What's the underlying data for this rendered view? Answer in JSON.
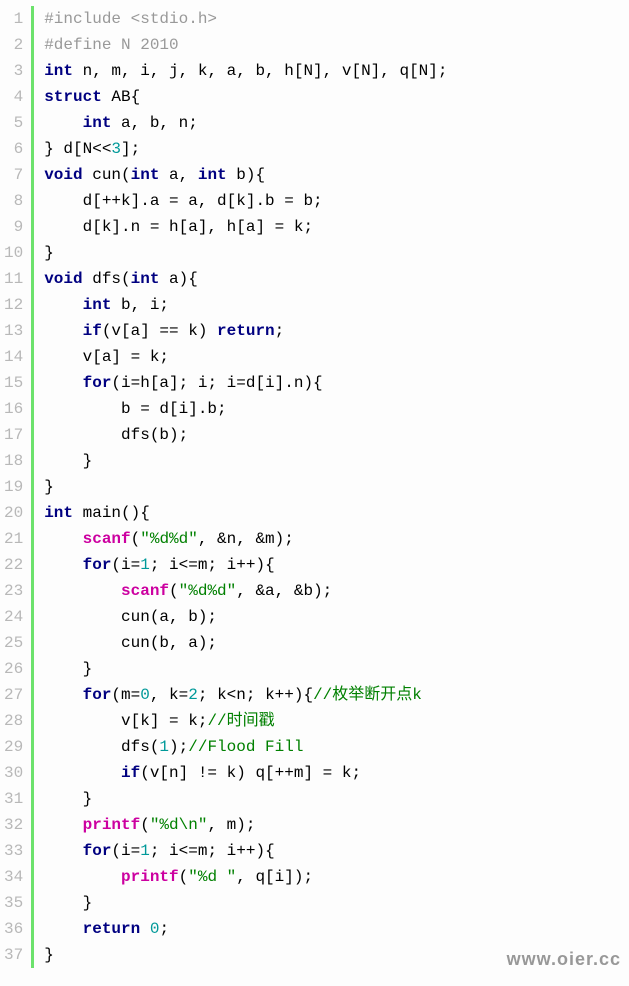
{
  "lineCount": 37,
  "lines": [
    [
      {
        "c": "kw-pp",
        "t": "#include <stdio.h>"
      }
    ],
    [
      {
        "c": "kw-pp",
        "t": "#define N 2010"
      }
    ],
    [
      {
        "c": "kw-type",
        "t": "int"
      },
      {
        "c": "id",
        "t": " n, m, i, j, k, a, b, h[N], v[N], q[N];"
      }
    ],
    [
      {
        "c": "kw-type",
        "t": "struct"
      },
      {
        "c": "id",
        "t": " AB{"
      }
    ],
    [
      {
        "c": "id",
        "t": "    "
      },
      {
        "c": "kw-type",
        "t": "int"
      },
      {
        "c": "id",
        "t": " a, b, n;"
      }
    ],
    [
      {
        "c": "id",
        "t": "} d[N<<"
      },
      {
        "c": "num",
        "t": "3"
      },
      {
        "c": "id",
        "t": "];"
      }
    ],
    [
      {
        "c": "kw-type",
        "t": "void"
      },
      {
        "c": "id",
        "t": " cun("
      },
      {
        "c": "kw-type",
        "t": "int"
      },
      {
        "c": "id",
        "t": " a, "
      },
      {
        "c": "kw-type",
        "t": "int"
      },
      {
        "c": "id",
        "t": " b){"
      }
    ],
    [
      {
        "c": "id",
        "t": "    d[++k].a = a, d[k].b = b;"
      }
    ],
    [
      {
        "c": "id",
        "t": "    d[k].n = h[a], h[a] = k;"
      }
    ],
    [
      {
        "c": "id",
        "t": "}"
      }
    ],
    [
      {
        "c": "kw-type",
        "t": "void"
      },
      {
        "c": "id",
        "t": " dfs("
      },
      {
        "c": "kw-type",
        "t": "int"
      },
      {
        "c": "id",
        "t": " a){"
      }
    ],
    [
      {
        "c": "id",
        "t": "    "
      },
      {
        "c": "kw-type",
        "t": "int"
      },
      {
        "c": "id",
        "t": " b, i;"
      }
    ],
    [
      {
        "c": "id",
        "t": "    "
      },
      {
        "c": "kw-ctrl",
        "t": "if"
      },
      {
        "c": "id",
        "t": "(v[a] == k) "
      },
      {
        "c": "kw-ctrl",
        "t": "return"
      },
      {
        "c": "id",
        "t": ";"
      }
    ],
    [
      {
        "c": "id",
        "t": "    v[a] = k;"
      }
    ],
    [
      {
        "c": "id",
        "t": "    "
      },
      {
        "c": "kw-ctrl",
        "t": "for"
      },
      {
        "c": "id",
        "t": "(i=h[a]; i; i=d[i].n){"
      }
    ],
    [
      {
        "c": "id",
        "t": "        b = d[i].b;"
      }
    ],
    [
      {
        "c": "id",
        "t": "        dfs(b);"
      }
    ],
    [
      {
        "c": "id",
        "t": "    }"
      }
    ],
    [
      {
        "c": "id",
        "t": "}"
      }
    ],
    [
      {
        "c": "kw-type",
        "t": "int"
      },
      {
        "c": "id",
        "t": " main(){"
      }
    ],
    [
      {
        "c": "id",
        "t": "    "
      },
      {
        "c": "fn",
        "t": "scanf"
      },
      {
        "c": "id",
        "t": "("
      },
      {
        "c": "str",
        "t": "\"%d%d\""
      },
      {
        "c": "id",
        "t": ", &n, &m);"
      }
    ],
    [
      {
        "c": "id",
        "t": "    "
      },
      {
        "c": "kw-ctrl",
        "t": "for"
      },
      {
        "c": "id",
        "t": "(i="
      },
      {
        "c": "num",
        "t": "1"
      },
      {
        "c": "id",
        "t": "; i<=m; i++){"
      }
    ],
    [
      {
        "c": "id",
        "t": "        "
      },
      {
        "c": "fn",
        "t": "scanf"
      },
      {
        "c": "id",
        "t": "("
      },
      {
        "c": "str",
        "t": "\"%d%d\""
      },
      {
        "c": "id",
        "t": ", &a, &b);"
      }
    ],
    [
      {
        "c": "id",
        "t": "        cun(a, b);"
      }
    ],
    [
      {
        "c": "id",
        "t": "        cun(b, a);"
      }
    ],
    [
      {
        "c": "id",
        "t": "    }"
      }
    ],
    [
      {
        "c": "id",
        "t": "    "
      },
      {
        "c": "kw-ctrl",
        "t": "for"
      },
      {
        "c": "id",
        "t": "(m="
      },
      {
        "c": "num",
        "t": "0"
      },
      {
        "c": "id",
        "t": ", k="
      },
      {
        "c": "num",
        "t": "2"
      },
      {
        "c": "id",
        "t": "; k<n; k++){"
      },
      {
        "c": "cmt",
        "t": "//枚举断开点k"
      }
    ],
    [
      {
        "c": "id",
        "t": "        v[k] = k;"
      },
      {
        "c": "cmt",
        "t": "//时间戳"
      }
    ],
    [
      {
        "c": "id",
        "t": "        dfs("
      },
      {
        "c": "num",
        "t": "1"
      },
      {
        "c": "id",
        "t": ");"
      },
      {
        "c": "cmt",
        "t": "//Flood Fill"
      }
    ],
    [
      {
        "c": "id",
        "t": "        "
      },
      {
        "c": "kw-ctrl",
        "t": "if"
      },
      {
        "c": "id",
        "t": "(v[n] != k) q[++m] = k;"
      }
    ],
    [
      {
        "c": "id",
        "t": "    }"
      }
    ],
    [
      {
        "c": "id",
        "t": "    "
      },
      {
        "c": "fn",
        "t": "printf"
      },
      {
        "c": "id",
        "t": "("
      },
      {
        "c": "str",
        "t": "\"%d\\n\""
      },
      {
        "c": "id",
        "t": ", m);"
      }
    ],
    [
      {
        "c": "id",
        "t": "    "
      },
      {
        "c": "kw-ctrl",
        "t": "for"
      },
      {
        "c": "id",
        "t": "(i="
      },
      {
        "c": "num",
        "t": "1"
      },
      {
        "c": "id",
        "t": "; i<=m; i++){"
      }
    ],
    [
      {
        "c": "id",
        "t": "        "
      },
      {
        "c": "fn",
        "t": "printf"
      },
      {
        "c": "id",
        "t": "("
      },
      {
        "c": "str",
        "t": "\"%d \""
      },
      {
        "c": "id",
        "t": ", q[i]);"
      }
    ],
    [
      {
        "c": "id",
        "t": "    }"
      }
    ],
    [
      {
        "c": "id",
        "t": "    "
      },
      {
        "c": "kw-ctrl",
        "t": "return"
      },
      {
        "c": "id",
        "t": " "
      },
      {
        "c": "num",
        "t": "0"
      },
      {
        "c": "id",
        "t": ";"
      }
    ],
    [
      {
        "c": "id",
        "t": "}"
      }
    ]
  ],
  "watermark": "www.oier.cc"
}
